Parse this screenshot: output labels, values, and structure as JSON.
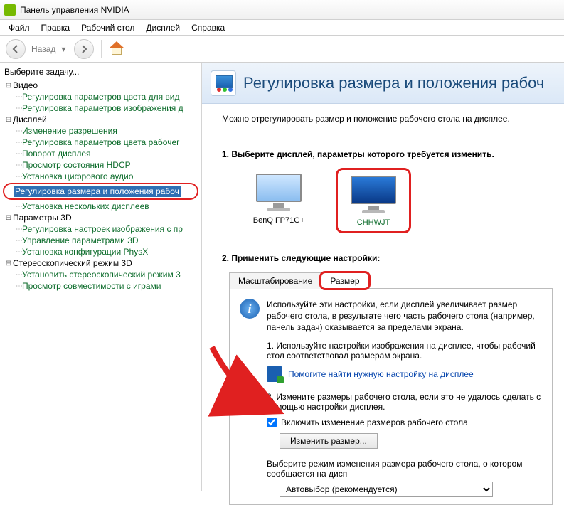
{
  "window": {
    "title": "Панель управления NVIDIA"
  },
  "menu": {
    "file": "Файл",
    "edit": "Правка",
    "desktop": "Рабочий стол",
    "display": "Дисплей",
    "help": "Справка"
  },
  "nav": {
    "back": "Назад"
  },
  "sidebar": {
    "label": "Выберите задачу...",
    "video": {
      "label": "Видео",
      "items": [
        "Регулировка параметров цвета для вид",
        "Регулировка параметров изображения д"
      ]
    },
    "display": {
      "label": "Дисплей",
      "items": [
        "Изменение разрешения",
        "Регулировка параметров цвета рабочег",
        "Поворот дисплея",
        "Просмотр состояния HDCP",
        "Установка цифрового аудио",
        "Регулировка размера и положения рабоч",
        "Установка нескольких дисплеев"
      ]
    },
    "params3d": {
      "label": "Параметры 3D",
      "items": [
        "Регулировка настроек изображения с пр",
        "Управление параметрами 3D",
        "Установка конфигурации PhysX"
      ]
    },
    "stereo": {
      "label": "Стереоскопический режим 3D",
      "items": [
        "Установить стереоскопический режим 3",
        "Просмотр совместимости с играми"
      ]
    }
  },
  "main": {
    "title": "Регулировка размера и положения рабоч",
    "intro": "Можно отрегулировать размер и положение рабочего стола на дисплее.",
    "step1": {
      "title": "1. Выберите дисплей, параметры которого требуется изменить.",
      "displays": [
        {
          "label": "BenQ FP71G+"
        },
        {
          "label": "CHHWJT"
        }
      ]
    },
    "step2": {
      "title": "2. Применить следующие настройки:",
      "tabs": {
        "scaling": "Масштабирование",
        "size": "Размер"
      },
      "info": "Используйте эти настройки, если дисплей увеличивает размер рабочего стола, в результате чего часть рабочего стола (например, панель задач) оказывается за пределами экрана.",
      "sub1": "1. Используйте настройки изображения на дисплее, чтобы рабочий стол соответствовал размерам экрана.",
      "link": "Помогите найти нужную настройку на дисплее",
      "sub2": "2. Измените размеры рабочего стола, если это не удалось сделать с помощью настройки дисплея.",
      "checkbox": "Включить изменение размеров рабочего стола",
      "button": "Изменить размер...",
      "note": "Выберите режим изменения размера рабочего стола, о котором сообщается на дисп",
      "select": "Автовыбор (рекомендуется)"
    }
  }
}
